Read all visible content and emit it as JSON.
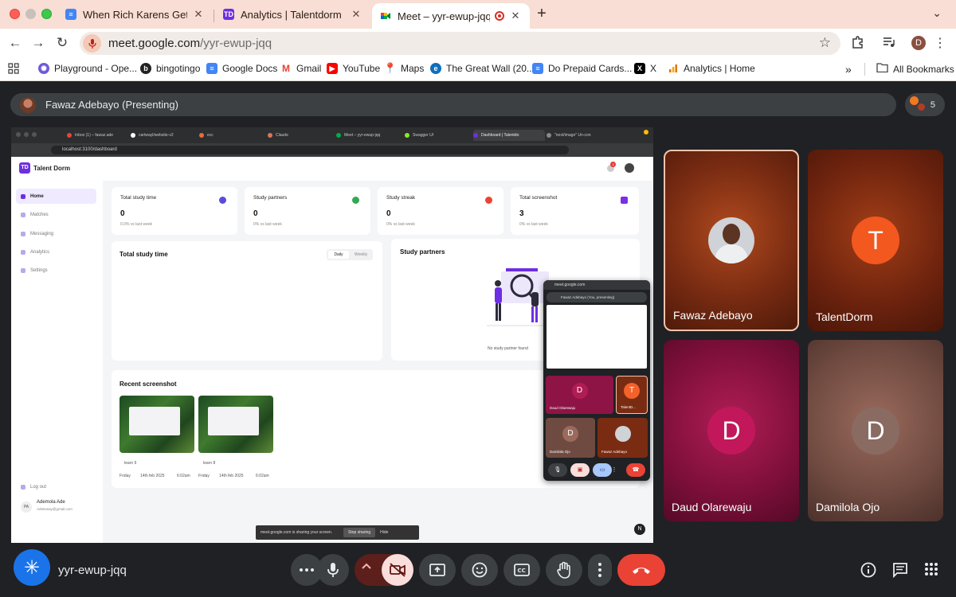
{
  "browser": {
    "tabs": [
      {
        "title": "When Rich Karens Get Arreste",
        "favicon": "docs-icon",
        "active": false
      },
      {
        "title": "Analytics | Talentdorm",
        "favicon": "talentdorm-icon",
        "active": false
      },
      {
        "title": "Meet – yyr-ewup-jqq",
        "favicon": "meet-icon",
        "active": true
      }
    ],
    "url_host": "meet.google.com",
    "url_path": "/yyr-ewup-jqq",
    "profile_initial": "D",
    "bookmarks": [
      {
        "label": "Playground - Ope...",
        "icon": "openai-icon"
      },
      {
        "label": "bingotingo",
        "icon": "bingotingo-icon"
      },
      {
        "label": "Google Docs",
        "icon": "docs-icon"
      },
      {
        "label": "Gmail",
        "icon": "gmail-icon"
      },
      {
        "label": "YouTube",
        "icon": "youtube-icon"
      },
      {
        "label": "Maps",
        "icon": "maps-icon"
      },
      {
        "label": "The Great Wall (20...",
        "icon": "edge-icon"
      },
      {
        "label": "Do Prepaid Cards...",
        "icon": "docs-icon"
      },
      {
        "label": "X",
        "icon": "x-icon"
      },
      {
        "label": "Analytics | Home",
        "icon": "analytics-icon"
      }
    ],
    "all_bookmarks": "All Bookmarks"
  },
  "meet": {
    "presenter_label": "Fawaz Adebayo (Presenting)",
    "participant_count": "5",
    "meeting_code": "yyr-ewup-jqq",
    "participants": [
      {
        "name": "Fawaz Adebayo",
        "letter": "",
        "has_photo": true
      },
      {
        "name": "TalentDorm",
        "letter": "T"
      },
      {
        "name": "Daud Olarewaju",
        "letter": "D"
      },
      {
        "name": "Damilola Ojo",
        "letter": "D"
      }
    ]
  },
  "shared_screen": {
    "tabs": [
      "Inbox (1) – fawaz.ade",
      "cartwayl/website-v2",
      "ecc",
      "Claude",
      "Meet – yyr-ewup-jqq",
      "Swagger UI",
      "Dashboard | Talentdo",
      "\"next/image\" Un-con"
    ],
    "url": "localhost:3100/dashboard",
    "app_name": "Talent Dorm",
    "nav": [
      "Home",
      "Matches",
      "Messaging",
      "Analytics",
      "Settings"
    ],
    "logout": "Log out",
    "user_name": "Ademola Ade",
    "user_email": "Adeteway@gmail.com",
    "user_initials": "PA",
    "notification_count": "3",
    "stats": [
      {
        "title": "Total study time",
        "value": "0",
        "sub": "0.0% vs last week"
      },
      {
        "title": "Study partners",
        "value": "0",
        "sub": "0% vs last week"
      },
      {
        "title": "Study streak",
        "value": "0",
        "sub": "0% vs last week"
      },
      {
        "title": "Total screenshot",
        "value": "3",
        "sub": "0% vs last week"
      }
    ],
    "study_time_title": "Total study time",
    "toggle_daily": "Daily",
    "toggle_weekly": "Weekly",
    "partners_title": "Study partners",
    "no_partners": "No study partner found",
    "recent_title": "Recent screenshot",
    "screenshots": [
      {
        "label": "learn 9",
        "day": "Friday",
        "date": "14th feb 2025",
        "time": "6:02am"
      },
      {
        "label": "learn 8",
        "day": "Friday",
        "date": "14th feb 2025",
        "time": "6:02am"
      }
    ],
    "share_banner": "meet.google.com is sharing your screen.",
    "stop_sharing": "Stop sharing",
    "hide": "Hide",
    "pip": {
      "url": "meet.google.com",
      "presenting": "Fawaz Adebayo (You, presenting)",
      "tiles": [
        {
          "name": "Daud Olarewaju",
          "letter": "D"
        },
        {
          "name": "TalentD...",
          "letter": "T"
        },
        {
          "name": "Damilola Ojo",
          "letter": "D"
        },
        {
          "name": "Fawaz Adebayo",
          "letter": ""
        }
      ]
    }
  },
  "colors": {
    "tabbar": "#f8ded4",
    "meet_bg": "#202124",
    "control_bg": "#3c4043",
    "end_call": "#ea4335",
    "camera_off": "#f9dedc",
    "accent_purple": "#6d2fe3"
  }
}
